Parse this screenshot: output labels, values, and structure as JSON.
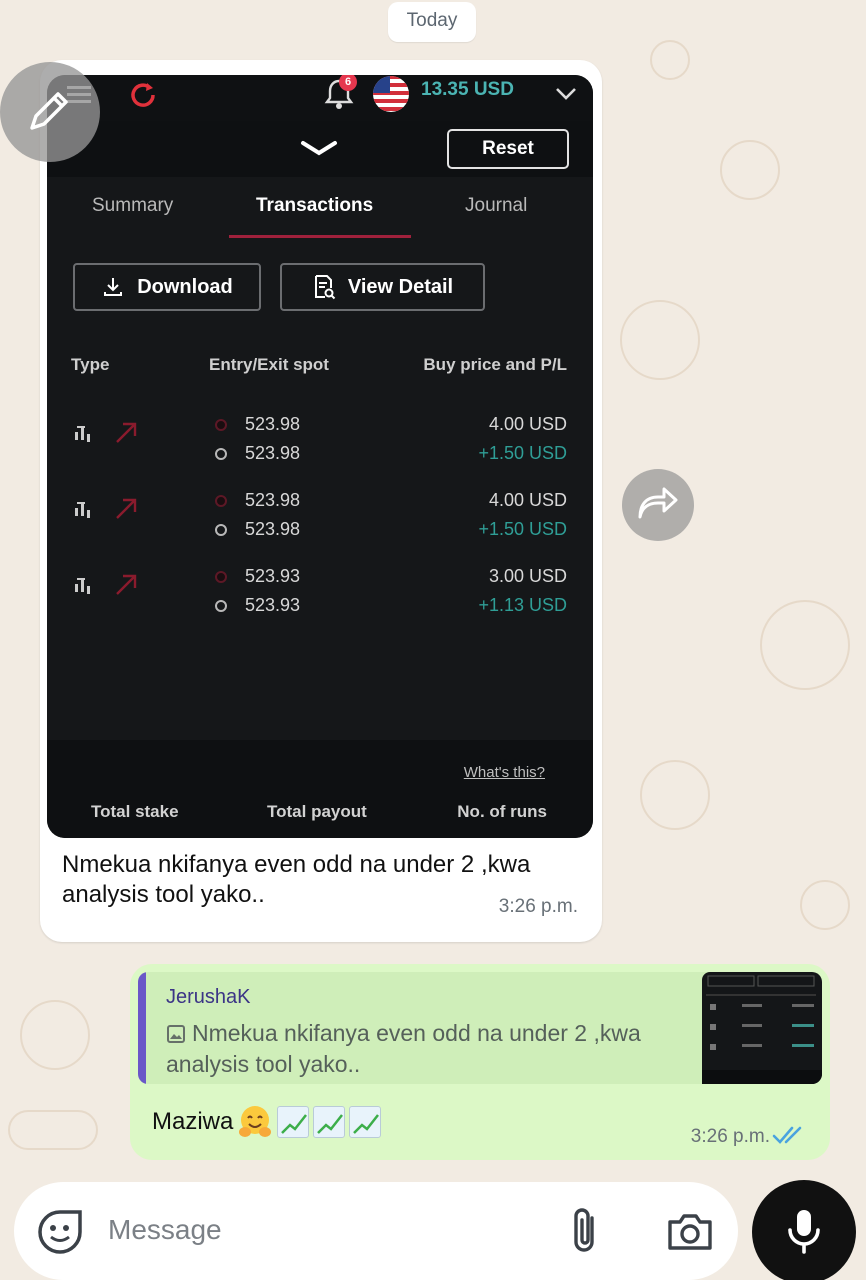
{
  "date_chip": "Today",
  "screenshot": {
    "balance": "13.35 USD",
    "notification_count": "6",
    "reset_label": "Reset",
    "tabs": [
      "Summary",
      "Transactions",
      "Journal"
    ],
    "download_label": "Download",
    "view_detail_label": "View Detail",
    "columns": [
      "Type",
      "Entry/Exit spot",
      "Buy price and P/L"
    ],
    "rows": [
      {
        "entry": "523.98",
        "exit": "523.98",
        "buy_price": "4.00 USD",
        "pl": "+1.50 USD"
      },
      {
        "entry": "523.98",
        "exit": "523.98",
        "buy_price": "4.00 USD",
        "pl": "+1.50 USD"
      },
      {
        "entry": "523.93",
        "exit": "523.93",
        "buy_price": "3.00 USD",
        "pl": "+1.13 USD"
      }
    ],
    "whats_this": "What's this?",
    "footer_headers": [
      "Total stake",
      "Total payout",
      "No. of runs"
    ]
  },
  "incoming_message": {
    "text": "Nmekua nkifanya even odd na under 2 ,kwa analysis tool yako..",
    "time": "3:26 p.m."
  },
  "outgoing_message": {
    "quote_author": "JerushaK",
    "quote_text": "Nmekua nkifanya even odd na under 2 ,kwa analysis tool yako..",
    "text": "Maziwa",
    "emojis": [
      "hugging-face",
      "chart-increasing",
      "chart-increasing",
      "chart-increasing"
    ],
    "time": "3:26 p.m."
  },
  "composer": {
    "placeholder": "Message"
  },
  "colors": {
    "wallpaper": "#f2ebe2",
    "outgoing_bubble": "#dcf8c6",
    "read_ticks": "#4aa3df",
    "profit": "#2f9e96",
    "balance": "#4bb4b3"
  }
}
